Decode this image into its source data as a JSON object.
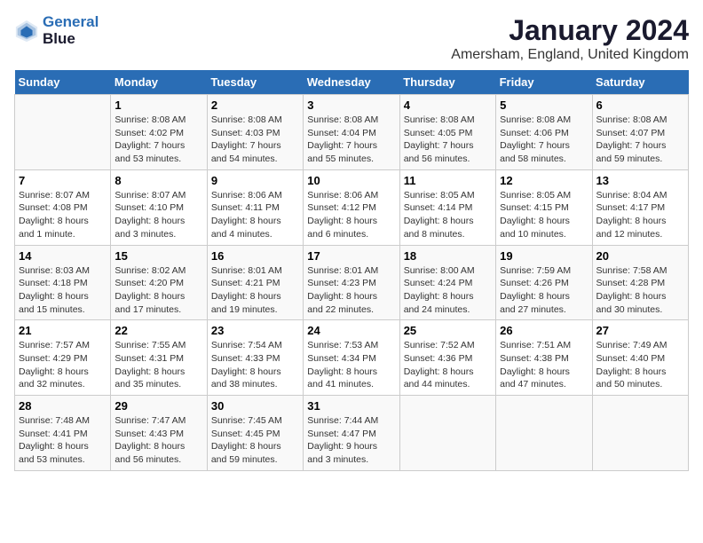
{
  "header": {
    "logo_line1": "General",
    "logo_line2": "Blue",
    "month": "January 2024",
    "location": "Amersham, England, United Kingdom"
  },
  "days_of_week": [
    "Sunday",
    "Monday",
    "Tuesday",
    "Wednesday",
    "Thursday",
    "Friday",
    "Saturday"
  ],
  "weeks": [
    [
      {
        "num": "",
        "info": ""
      },
      {
        "num": "1",
        "info": "Sunrise: 8:08 AM\nSunset: 4:02 PM\nDaylight: 7 hours\nand 53 minutes."
      },
      {
        "num": "2",
        "info": "Sunrise: 8:08 AM\nSunset: 4:03 PM\nDaylight: 7 hours\nand 54 minutes."
      },
      {
        "num": "3",
        "info": "Sunrise: 8:08 AM\nSunset: 4:04 PM\nDaylight: 7 hours\nand 55 minutes."
      },
      {
        "num": "4",
        "info": "Sunrise: 8:08 AM\nSunset: 4:05 PM\nDaylight: 7 hours\nand 56 minutes."
      },
      {
        "num": "5",
        "info": "Sunrise: 8:08 AM\nSunset: 4:06 PM\nDaylight: 7 hours\nand 58 minutes."
      },
      {
        "num": "6",
        "info": "Sunrise: 8:08 AM\nSunset: 4:07 PM\nDaylight: 7 hours\nand 59 minutes."
      }
    ],
    [
      {
        "num": "7",
        "info": "Sunrise: 8:07 AM\nSunset: 4:08 PM\nDaylight: 8 hours\nand 1 minute."
      },
      {
        "num": "8",
        "info": "Sunrise: 8:07 AM\nSunset: 4:10 PM\nDaylight: 8 hours\nand 3 minutes."
      },
      {
        "num": "9",
        "info": "Sunrise: 8:06 AM\nSunset: 4:11 PM\nDaylight: 8 hours\nand 4 minutes."
      },
      {
        "num": "10",
        "info": "Sunrise: 8:06 AM\nSunset: 4:12 PM\nDaylight: 8 hours\nand 6 minutes."
      },
      {
        "num": "11",
        "info": "Sunrise: 8:05 AM\nSunset: 4:14 PM\nDaylight: 8 hours\nand 8 minutes."
      },
      {
        "num": "12",
        "info": "Sunrise: 8:05 AM\nSunset: 4:15 PM\nDaylight: 8 hours\nand 10 minutes."
      },
      {
        "num": "13",
        "info": "Sunrise: 8:04 AM\nSunset: 4:17 PM\nDaylight: 8 hours\nand 12 minutes."
      }
    ],
    [
      {
        "num": "14",
        "info": "Sunrise: 8:03 AM\nSunset: 4:18 PM\nDaylight: 8 hours\nand 15 minutes."
      },
      {
        "num": "15",
        "info": "Sunrise: 8:02 AM\nSunset: 4:20 PM\nDaylight: 8 hours\nand 17 minutes."
      },
      {
        "num": "16",
        "info": "Sunrise: 8:01 AM\nSunset: 4:21 PM\nDaylight: 8 hours\nand 19 minutes."
      },
      {
        "num": "17",
        "info": "Sunrise: 8:01 AM\nSunset: 4:23 PM\nDaylight: 8 hours\nand 22 minutes."
      },
      {
        "num": "18",
        "info": "Sunrise: 8:00 AM\nSunset: 4:24 PM\nDaylight: 8 hours\nand 24 minutes."
      },
      {
        "num": "19",
        "info": "Sunrise: 7:59 AM\nSunset: 4:26 PM\nDaylight: 8 hours\nand 27 minutes."
      },
      {
        "num": "20",
        "info": "Sunrise: 7:58 AM\nSunset: 4:28 PM\nDaylight: 8 hours\nand 30 minutes."
      }
    ],
    [
      {
        "num": "21",
        "info": "Sunrise: 7:57 AM\nSunset: 4:29 PM\nDaylight: 8 hours\nand 32 minutes."
      },
      {
        "num": "22",
        "info": "Sunrise: 7:55 AM\nSunset: 4:31 PM\nDaylight: 8 hours\nand 35 minutes."
      },
      {
        "num": "23",
        "info": "Sunrise: 7:54 AM\nSunset: 4:33 PM\nDaylight: 8 hours\nand 38 minutes."
      },
      {
        "num": "24",
        "info": "Sunrise: 7:53 AM\nSunset: 4:34 PM\nDaylight: 8 hours\nand 41 minutes."
      },
      {
        "num": "25",
        "info": "Sunrise: 7:52 AM\nSunset: 4:36 PM\nDaylight: 8 hours\nand 44 minutes."
      },
      {
        "num": "26",
        "info": "Sunrise: 7:51 AM\nSunset: 4:38 PM\nDaylight: 8 hours\nand 47 minutes."
      },
      {
        "num": "27",
        "info": "Sunrise: 7:49 AM\nSunset: 4:40 PM\nDaylight: 8 hours\nand 50 minutes."
      }
    ],
    [
      {
        "num": "28",
        "info": "Sunrise: 7:48 AM\nSunset: 4:41 PM\nDaylight: 8 hours\nand 53 minutes."
      },
      {
        "num": "29",
        "info": "Sunrise: 7:47 AM\nSunset: 4:43 PM\nDaylight: 8 hours\nand 56 minutes."
      },
      {
        "num": "30",
        "info": "Sunrise: 7:45 AM\nSunset: 4:45 PM\nDaylight: 8 hours\nand 59 minutes."
      },
      {
        "num": "31",
        "info": "Sunrise: 7:44 AM\nSunset: 4:47 PM\nDaylight: 9 hours\nand 3 minutes."
      },
      {
        "num": "",
        "info": ""
      },
      {
        "num": "",
        "info": ""
      },
      {
        "num": "",
        "info": ""
      }
    ]
  ]
}
